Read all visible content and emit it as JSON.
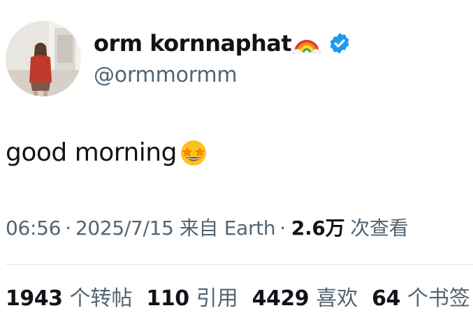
{
  "user": {
    "display_name": "orm kornnaphat",
    "handle": "@ormmormm",
    "name_emoji": "rainbow-icon",
    "verified": true,
    "verified_color": "#1d9bf0"
  },
  "tweet": {
    "text": "good morning",
    "text_emoji": "star-struck-icon"
  },
  "meta": {
    "time": "06:56",
    "separator": "·",
    "date": "2025/7/15",
    "source": "来自 Earth",
    "views_count": "2.6万",
    "views_label": "次查看"
  },
  "stats": [
    {
      "count": "1943",
      "label": "个转帖"
    },
    {
      "count": "110",
      "label": "引用"
    },
    {
      "count": "4429",
      "label": "喜欢"
    },
    {
      "count": "64",
      "label": "个书签"
    }
  ],
  "colors": {
    "text_primary": "#0f1419",
    "text_secondary": "#536471",
    "divider": "#e1e8ed",
    "accent": "#1d9bf0"
  }
}
